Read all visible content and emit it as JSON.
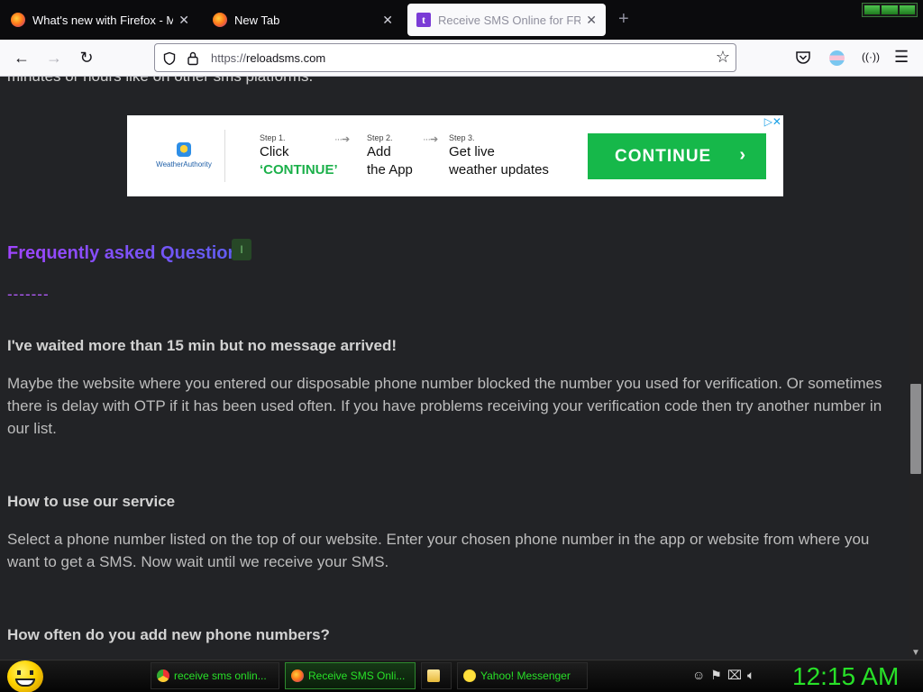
{
  "browser": {
    "tabs": [
      {
        "title": "What's new with Firefox - More",
        "icon": "firefox-icon"
      },
      {
        "title": "New Tab",
        "icon": "firefox-icon"
      },
      {
        "title": "Receive SMS Online for FREE",
        "icon": "t-site-icon",
        "active": true
      }
    ],
    "new_tab_glyph": "+",
    "url_prefix": "https://",
    "url_host": "reloadsms.com"
  },
  "page": {
    "cut_off_text": "minutes or hours like on other sms platforms.",
    "ad": {
      "brand": "WeatherAuthority",
      "steps": [
        {
          "label": "Step 1.",
          "line1": "Click",
          "line2": "‘CONTINUE’"
        },
        {
          "label": "Step 2.",
          "line1": "Add",
          "line2": "the App"
        },
        {
          "label": "Step 3.",
          "line1": "Get live",
          "line2": "weather updates"
        }
      ],
      "cta": "CONTINUE"
    },
    "faq_heading": "Frequently asked Questions",
    "faq_divider": "-------",
    "faqs": [
      {
        "q": "I've waited more than 15 min but no message arrived!",
        "a": "Maybe the website where you entered our disposable phone number blocked the number you used for verification. Or sometimes there is delay with OTP if it has been used often. If you have problems receiving your verification code then try another number in our list."
      },
      {
        "q": "How to use our service",
        "a": "Select a phone number listed on the top of our website. Enter your chosen phone number in the app or website from where you want to get a SMS. Now wait until we receive your SMS."
      },
      {
        "q": "How often do you add new phone numbers?",
        "a": ""
      }
    ]
  },
  "taskbar": {
    "items": [
      {
        "label": "receive sms onlin...",
        "icon": "chrome-icon"
      },
      {
        "label": "Receive SMS Onli...",
        "icon": "firefox-icon",
        "active": true
      },
      {
        "label": "",
        "icon": "folder-icon"
      },
      {
        "label": "Yahoo! Messenger",
        "icon": "yahoo-messenger-icon"
      }
    ],
    "clock": "12:15 AM"
  },
  "colors": {
    "page_bg": "#222326",
    "faq_heading_start": "#a044ff",
    "faq_heading_end": "#5b5ff0",
    "cta_green": "#16b84a",
    "taskbar_text": "#28e028"
  }
}
